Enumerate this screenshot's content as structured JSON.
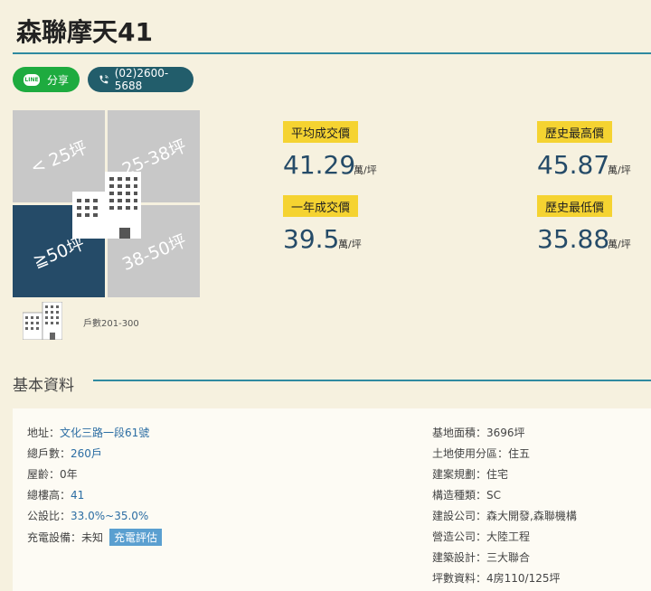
{
  "title": "森聯摩天41",
  "buttons": {
    "share_label": "分享",
    "line_badge": "LINE",
    "phone": "(02)2600-5688"
  },
  "size_grid": [
    {
      "label": "< 25坪",
      "selected": false
    },
    {
      "label": "25-38坪",
      "selected": false
    },
    {
      "label": "≧50坪",
      "selected": true
    },
    {
      "label": "38-50坪",
      "selected": false
    }
  ],
  "households": "戶數201-300",
  "stats": {
    "avg": {
      "label": "平均成交價",
      "value": "41.29",
      "unit": "萬/坪"
    },
    "high": {
      "label": "歷史最高價",
      "value": "45.87",
      "unit": "萬/坪"
    },
    "year": {
      "label": "一年成交價",
      "value": "39.5",
      "unit": "萬/坪"
    },
    "low": {
      "label": "歷史最低價",
      "value": "35.88",
      "unit": "萬/坪"
    }
  },
  "basic_info": {
    "title": "基本資料",
    "left": [
      {
        "label": "地址：",
        "value": "文化三路一段61號",
        "link": true
      },
      {
        "label": "總戶數：",
        "value": "260戶",
        "link": false
      },
      {
        "label": "屋齡：",
        "value": "0年",
        "link": false
      },
      {
        "label": "總樓高：",
        "value": "41",
        "link": false
      },
      {
        "label": "公設比：",
        "value": "33.0%~35.0%",
        "link": false
      },
      {
        "label": "充電設備：",
        "value": "未知",
        "link": false,
        "tag": "充電評估"
      }
    ],
    "right": [
      {
        "label": "基地面積：",
        "value": "3696坪"
      },
      {
        "label": "土地使用分區：",
        "value": "住五"
      },
      {
        "label": "建案規劃：",
        "value": "住宅"
      },
      {
        "label": "構造種類：",
        "value": "SC"
      },
      {
        "label": "建設公司：",
        "value": "森大開發,森聯機構"
      },
      {
        "label": "營造公司：",
        "value": "大陸工程"
      },
      {
        "label": "建築設計：",
        "value": "三大聯合"
      },
      {
        "label": "坪數資料：",
        "value": "4房110/125坪"
      }
    ]
  },
  "colors": {
    "background": "#f6f1df",
    "accent_rule": "#2f8aa0",
    "share": "#1eab3f",
    "phone": "#225d6b",
    "selected_cell": "#254b68",
    "label_yellow": "#f5d331",
    "value_blue": "#254b68"
  }
}
